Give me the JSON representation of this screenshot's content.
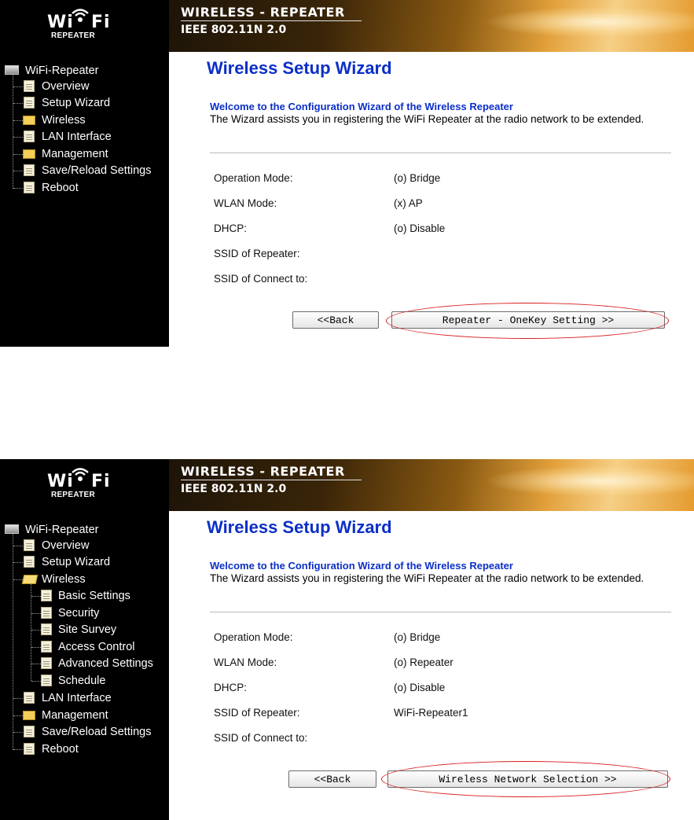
{
  "brand": {
    "logo_wi": "Wi",
    "logo_fi": "Fi",
    "logo_sub": "REPEATER",
    "header_line1": "WIRELESS - REPEATER",
    "header_line2": "IEEE 802.11N 2.0"
  },
  "panels": [
    {
      "sidebar": {
        "root": "WiFi-Repeater",
        "items": [
          {
            "label": "Overview",
            "icon": "document-icon"
          },
          {
            "label": "Setup Wizard",
            "icon": "document-icon"
          },
          {
            "label": "Wireless",
            "icon": "folder-icon"
          },
          {
            "label": "LAN Interface",
            "icon": "document-icon"
          },
          {
            "label": "Management",
            "icon": "folder-icon"
          },
          {
            "label": "Save/Reload Settings",
            "icon": "document-icon"
          },
          {
            "label": "Reboot",
            "icon": "document-icon"
          }
        ]
      },
      "main": {
        "title": "Wireless Setup Wizard",
        "welcome": "Welcome to the Configuration Wizard of the Wireless Repeater",
        "description": "The Wizard assists you in registering the WiFi Repeater at the radio network to be extended.",
        "fields": [
          {
            "label": "Operation Mode:",
            "value": "(o) Bridge"
          },
          {
            "label": "WLAN Mode:",
            "value": "(x) AP"
          },
          {
            "label": "DHCP:",
            "value": "(o) Disable"
          },
          {
            "label": "SSID of Repeater:",
            "value": ""
          },
          {
            "label": "SSID of Connect to:",
            "value": ""
          }
        ],
        "back_label": "<<Back",
        "next_label": "Repeater - OneKey Setting >>",
        "highlight_color": "#d81c1c"
      }
    },
    {
      "sidebar": {
        "root": "WiFi-Repeater",
        "items": [
          {
            "label": "Overview",
            "icon": "document-icon"
          },
          {
            "label": "Setup Wizard",
            "icon": "document-icon"
          },
          {
            "label": "Wireless",
            "icon": "folder-open-icon"
          },
          {
            "label": "Basic Settings",
            "icon": "document-icon"
          },
          {
            "label": "Security",
            "icon": "document-icon"
          },
          {
            "label": "Site Survey",
            "icon": "document-icon"
          },
          {
            "label": "Access Control",
            "icon": "document-icon"
          },
          {
            "label": "Advanced Settings",
            "icon": "document-icon"
          },
          {
            "label": "Schedule",
            "icon": "document-icon"
          },
          {
            "label": "LAN Interface",
            "icon": "document-icon"
          },
          {
            "label": "Management",
            "icon": "folder-icon"
          },
          {
            "label": "Save/Reload Settings",
            "icon": "document-icon"
          },
          {
            "label": "Reboot",
            "icon": "document-icon"
          }
        ]
      },
      "main": {
        "title": "Wireless Setup Wizard",
        "welcome": "Welcome to the Configuration Wizard of the Wireless Repeater",
        "description": "The Wizard assists you in registering the WiFi Repeater at the radio network to be extended.",
        "fields": [
          {
            "label": "Operation Mode:",
            "value": "(o) Bridge"
          },
          {
            "label": "WLAN Mode:",
            "value": "(o) Repeater"
          },
          {
            "label": "DHCP:",
            "value": "(o) Disable"
          },
          {
            "label": "SSID of Repeater:",
            "value": "WiFi-Repeater1"
          },
          {
            "label": "SSID of Connect to:",
            "value": ""
          }
        ],
        "back_label": "<<Back",
        "next_label": "Wireless Network Selection >>",
        "highlight_color": "#d81c1c"
      }
    }
  ]
}
